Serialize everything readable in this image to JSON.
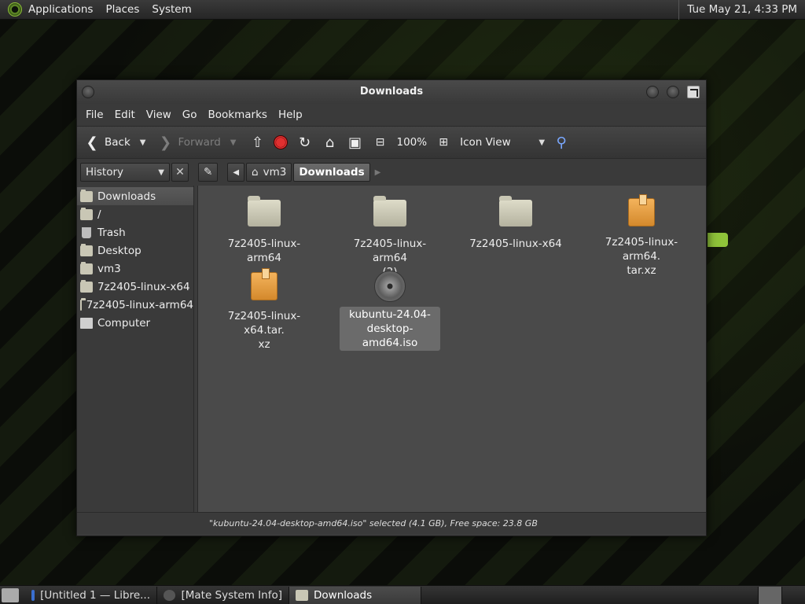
{
  "top_panel": {
    "menu": [
      "Applications",
      "Places",
      "System"
    ],
    "clock": "Tue May 21,  4:33 PM"
  },
  "window": {
    "title": "Downloads",
    "menubar": [
      "File",
      "Edit",
      "View",
      "Go",
      "Bookmarks",
      "Help"
    ],
    "toolbar": {
      "back": "Back",
      "forward": "Forward",
      "zoom": "100%",
      "view_mode": "Icon View"
    },
    "sidebar_mode": "History",
    "path": [
      "vm3",
      "Downloads"
    ],
    "sidebar": [
      {
        "label": "Downloads",
        "icon": "folder-icon"
      },
      {
        "label": "/",
        "icon": "folder-icon"
      },
      {
        "label": "Trash",
        "icon": "trash-icon"
      },
      {
        "label": "Desktop",
        "icon": "folder-icon"
      },
      {
        "label": "vm3",
        "icon": "home-folder-icon"
      },
      {
        "label": "7z2405-linux-x64",
        "icon": "folder-icon"
      },
      {
        "label": "7z2405-linux-arm64",
        "icon": "folder-icon"
      },
      {
        "label": "Computer",
        "icon": "computer-icon"
      }
    ],
    "files": [
      {
        "name": "7z2405-linux-arm64",
        "type": "folder"
      },
      {
        "name": "7z2405-linux-arm64\n(2)",
        "type": "folder"
      },
      {
        "name": "7z2405-linux-x64",
        "type": "folder"
      },
      {
        "name": "7z2405-linux-arm64.\ntar.xz",
        "type": "archive"
      },
      {
        "name": "7z2405-linux-x64.tar.\nxz",
        "type": "archive"
      },
      {
        "name": "kubuntu-24.04-\ndesktop-amd64.iso",
        "type": "disc"
      }
    ],
    "status": "\"kubuntu-24.04-desktop-amd64.iso\" selected (4.1 GB), Free space: 23.8 GB"
  },
  "taskbar": {
    "tasks": [
      "[Untitled 1 — Libre...",
      "[Mate System Info]",
      "Downloads"
    ]
  }
}
